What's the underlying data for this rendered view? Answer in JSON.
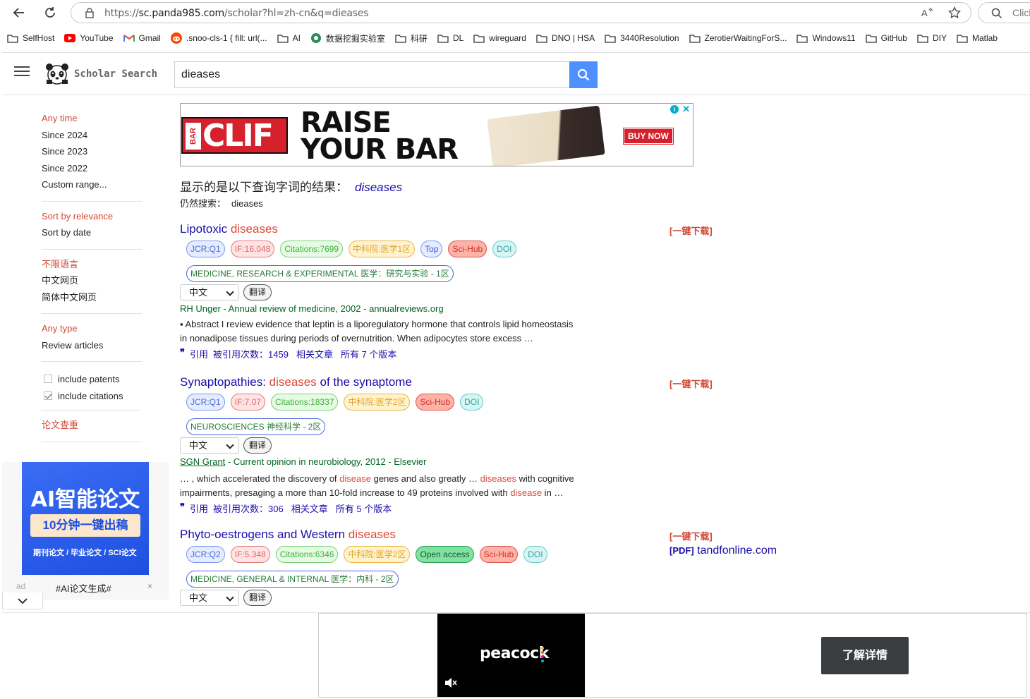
{
  "browser": {
    "url_prefix": "https://",
    "url_host": "sc.panda985.com",
    "url_path": "/scholar?hl=zh-cn&q=dieases",
    "search_placeholder": "Click"
  },
  "bookmarks": [
    {
      "label": "SelfHost",
      "icon": "folder-icon"
    },
    {
      "label": "YouTube",
      "icon": "youtube-icon"
    },
    {
      "label": "Gmail",
      "icon": "gmail-icon"
    },
    {
      "label": ".snoo-cls-1 { fill: url(...",
      "icon": "reddit-icon"
    },
    {
      "label": "AI",
      "icon": "folder-icon"
    },
    {
      "label": "数据挖掘实验室",
      "icon": "lab-icon"
    },
    {
      "label": "科研",
      "icon": "folder-icon"
    },
    {
      "label": "DL",
      "icon": "folder-icon"
    },
    {
      "label": "wireguard",
      "icon": "folder-icon"
    },
    {
      "label": "DNO | HSA",
      "icon": "folder-icon"
    },
    {
      "label": "3440Resolution",
      "icon": "folder-icon"
    },
    {
      "label": "ZerotierWaitingForS...",
      "icon": "folder-icon"
    },
    {
      "label": "Windows11",
      "icon": "folder-icon"
    },
    {
      "label": "GitHub",
      "icon": "folder-icon"
    },
    {
      "label": "DIY",
      "icon": "folder-icon"
    },
    {
      "label": "Matlab",
      "icon": "folder-icon"
    }
  ],
  "header": {
    "logo_text": "Scholar Search",
    "query": "dieases"
  },
  "sidebar": {
    "time": [
      "Any time",
      "Since 2024",
      "Since 2023",
      "Since 2022",
      "Custom range..."
    ],
    "sort": [
      "Sort by relevance",
      "Sort by date"
    ],
    "lang": [
      "不限语言",
      "中文网页",
      "简体中文网页"
    ],
    "type": [
      "Any type",
      "Review articles"
    ],
    "include_patents": "include patents",
    "include_citations": "include citations",
    "plagiarism": "论文查重"
  },
  "side_ad": {
    "title": "AI智能论文",
    "pill": "10分钟一键出稿",
    "sub": "期刊论文 / 毕业论文 / SCI论文",
    "label": "ad",
    "tag": "#AI论文生成#",
    "close": "×"
  },
  "banner_ad": {
    "brand": "CLIF",
    "bar": "BAR",
    "line1": "RAISE",
    "line2": "YOUR BAR",
    "cta": "BUY NOW"
  },
  "correction": {
    "prefix": "显示的是以下查询字词的结果：",
    "corrected": "diseases",
    "still_label": "仍然搜索：",
    "original": "dieases"
  },
  "results": [
    {
      "title_pre": "Lipotoxic ",
      "title_hl": "diseases",
      "title_post": "",
      "download": "[一键下载]",
      "badges": {
        "jcr": "JCR:Q1",
        "if": "IF:16.048",
        "cit": "Citations:7699",
        "cas": "中科院:医学1区",
        "top": "Top",
        "sci": "Sci-Hub",
        "doi": "DOI"
      },
      "category": "MEDICINE, RESEARCH & EXPERIMENTAL 医学：研究与实验 - 1区",
      "lang": "中文",
      "translate": "翻译",
      "author_link": "",
      "author": "RH Unger - Annual review of medicine, 2002 - annualreviews.org",
      "snippet_1": "▪ Abstract I review evidence that leptin is a liporegulatory hormone that controls lipid homeostasis in nonadipose tissues during periods of overnutrition. When adipocytes store excess …",
      "cite": "引用",
      "cited_by": "被引用次数：1459",
      "related": "相关文章",
      "versions": "所有 7 个版本"
    },
    {
      "title_pre": "Synaptopathies: ",
      "title_hl": "diseases",
      "title_post": " of the synaptome",
      "download": "[一键下载]",
      "badges": {
        "jcr": "JCR:Q1",
        "if": "IF:7.07",
        "cit": "Citations:18337",
        "cas": "中科院:医学2区",
        "sci": "Sci-Hub",
        "doi": "DOI"
      },
      "category": "NEUROSCIENCES 神经科学 - 2区",
      "lang": "中文",
      "translate": "翻译",
      "author_link": "SGN Grant",
      "author": " - Current opinion in neurobiology, 2012 - Elsevier",
      "snippet_a": "… , which accelerated the discovery of ",
      "snippet_b": "disease",
      "snippet_c": " genes and also greatly … ",
      "snippet_d": "diseases",
      "snippet_e": " with cognitive impairments, presaging a more than 10-fold increase to 49 proteins involved with ",
      "snippet_f": "disease",
      "snippet_g": " in …",
      "cite": "引用",
      "cited_by": "被引用次数：306",
      "related": "相关文章",
      "versions": "所有 5 个版本"
    },
    {
      "title_pre": "Phyto-oestrogens and Western ",
      "title_hl": "diseases",
      "title_post": "",
      "download": "[一键下载]",
      "pdf_tag": "[PDF]",
      "pdf_host": "tandfonline.com",
      "badges": {
        "jcr": "JCR:Q2",
        "if": "IF:5.348",
        "cit": "Citations:6346",
        "cas": "中科院:医学2区",
        "oa": "Open access",
        "sci": "Sci-Hub",
        "doi": "DOI"
      },
      "category": "MEDICINE, GENERAL & INTERNAL 医学：内科 - 2区",
      "lang": "中文",
      "translate": "翻译"
    }
  ],
  "bottom_ad": {
    "brand": "peacock",
    "cta": "了解详情"
  },
  "colors": {
    "accent": "#4d90fe",
    "link": "#1a0dab",
    "highlight": "#dd4b39",
    "author": "#006621"
  }
}
